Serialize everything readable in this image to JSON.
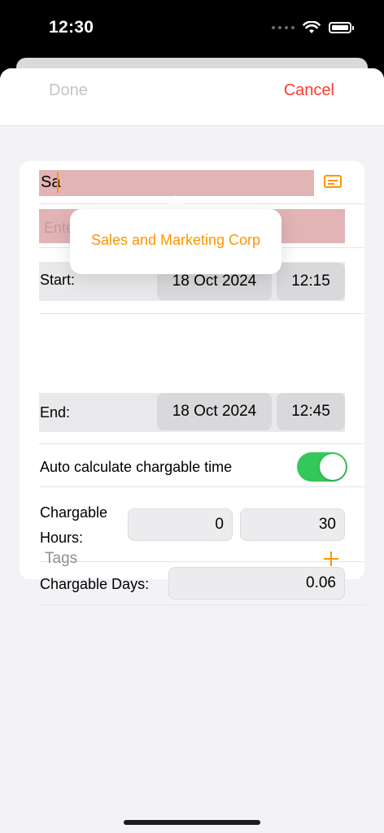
{
  "status": {
    "time": "12:30"
  },
  "nav": {
    "done": "Done",
    "cancel": "Cancel"
  },
  "name_field": {
    "value": "Sa"
  },
  "secondary_field": {
    "placeholder": "Ente"
  },
  "start": {
    "label": "Start:",
    "date": "18 Oct 2024",
    "time": "12:15"
  },
  "end": {
    "label": "End:",
    "date": "18 Oct 2024",
    "time": "12:45"
  },
  "auto_calc": {
    "label": "Auto calculate chargable time",
    "enabled": true
  },
  "chargable_hours": {
    "label_line1": "Chargable",
    "label_line2": "Hours:",
    "hours": "0",
    "minutes": "30"
  },
  "chargable_days": {
    "label": "Chargable Days:",
    "value": "0.06"
  },
  "tags": {
    "label": "Tags"
  },
  "suggestion": {
    "text": "Sales and Marketing Corp"
  },
  "colors": {
    "accent": "#ff9500",
    "cancel": "#ff3b30",
    "toggle_on": "#34c759",
    "field_highlight": "#e2b4b6"
  }
}
